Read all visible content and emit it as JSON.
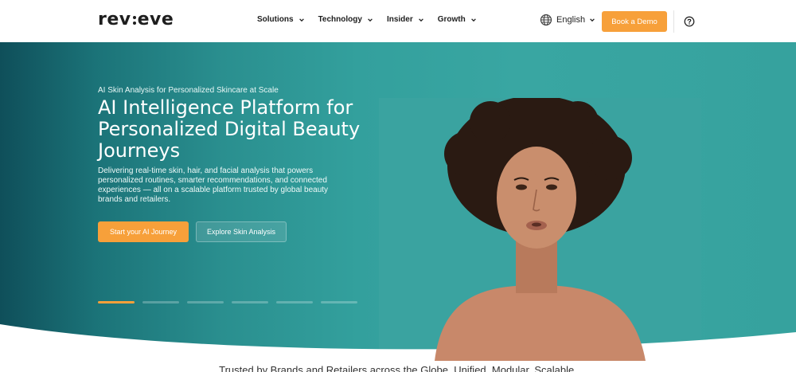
{
  "brand": {
    "logo_left": "rev",
    "logo_right": "eve"
  },
  "nav": {
    "items": [
      {
        "label": "Solutions"
      },
      {
        "label": "Technology"
      },
      {
        "label": "Insider"
      },
      {
        "label": "Growth"
      }
    ],
    "language": "English",
    "cta": "Book a Demo"
  },
  "hero": {
    "eyebrow": "AI Skin Analysis for Personalized Skincare at Scale",
    "headline": "AI Intelligence Platform for Personalized Digital Beauty Journeys",
    "subtext": "Delivering real-time skin, hair, and facial analysis that powers personalized routines, smarter recommendations, and connected experiences — all on a scalable platform trusted by global beauty brands and retailers.",
    "primary_button": "Start your AI Journey",
    "secondary_button": "Explore Skin Analysis",
    "slides_total": 6,
    "slide_active": 1
  },
  "trusted_text": "Trusted by Brands and Retailers across the Globe. Unified. Modular. Scalable.",
  "colors": {
    "accent": "#f7a03a",
    "hero_teal": "#36a29e",
    "hero_dark": "#0f4f5a"
  },
  "icons": {
    "nav_chevron": "chevron-down-icon",
    "language": "globe-icon",
    "help": "help-circle-icon"
  }
}
